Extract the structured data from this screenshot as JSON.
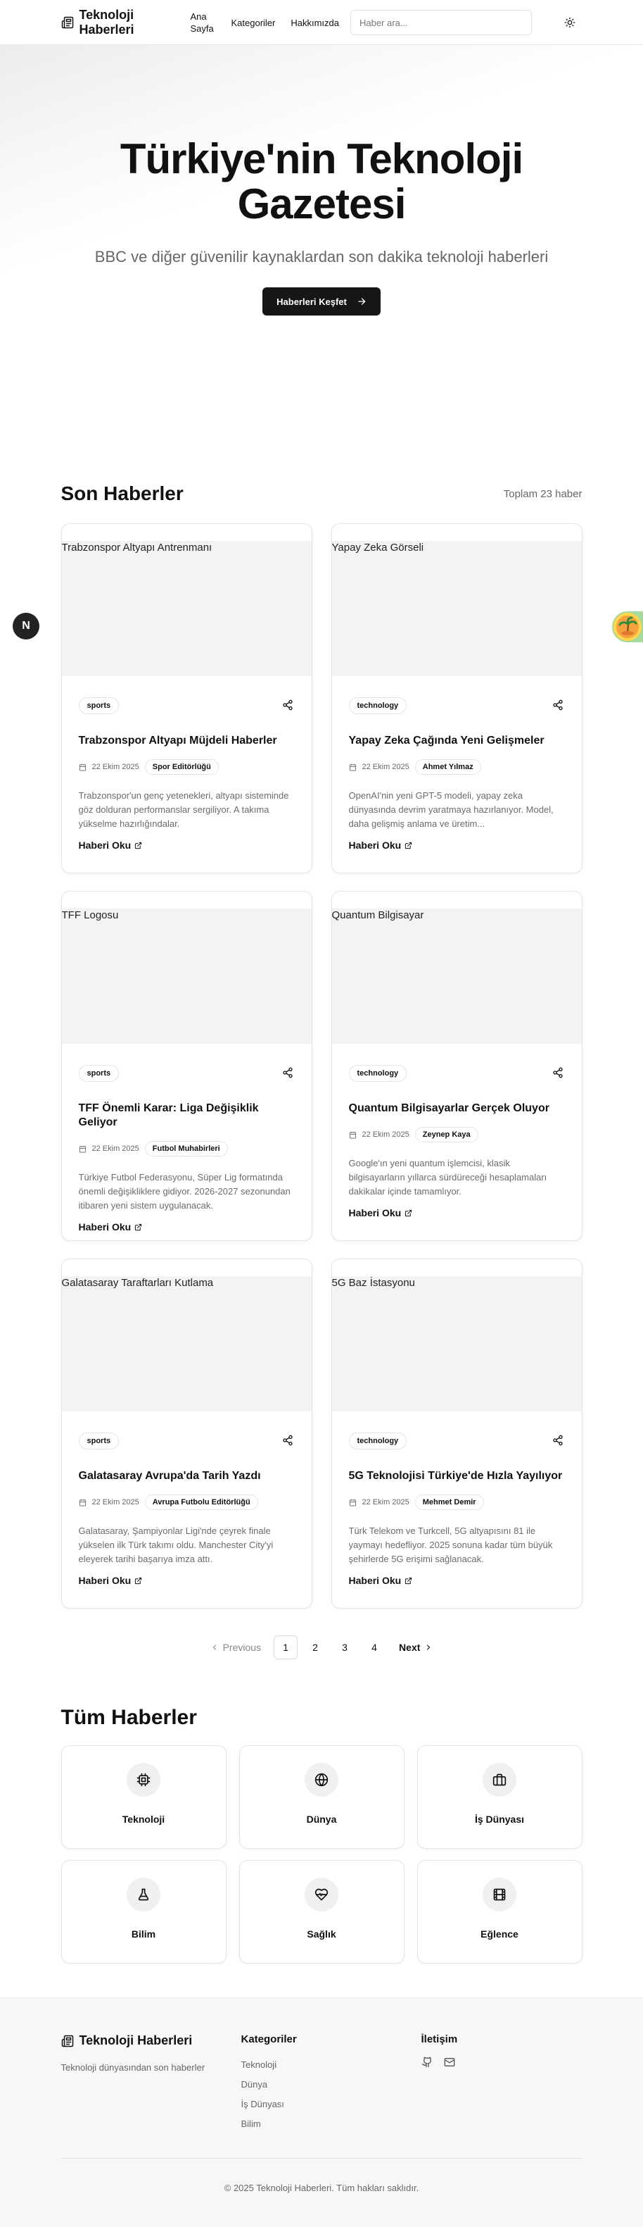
{
  "header": {
    "title": "Teknoloji Haberleri",
    "nav": [
      "Ana Sayfa",
      "Kategoriler",
      "Hakkımızda"
    ],
    "search_placeholder": "Haber ara..."
  },
  "hero": {
    "title": "Türkiye'nin Teknoloji Gazetesi",
    "subtitle": "BBC ve diğer güvenilir kaynaklardan son dakika teknoloji haberleri",
    "button": "Haberleri Keşfet"
  },
  "latest": {
    "title": "Son Haberler",
    "count": "Toplam 23 haber",
    "read_label": "Haberi Oku",
    "articles": [
      {
        "image_alt": "Trabzonspor Altyapı Antrenmanı",
        "category": "sports",
        "title": "Trabzonspor Altyapı Müjdeli Haberler",
        "date": "22 Ekim 2025",
        "author": "Spor Editörlüğü",
        "desc": "Trabzonspor'un genç yetenekleri, altyapı sisteminde göz dolduran performanslar sergiliyor. A takıma yükselme hazırlığındalar."
      },
      {
        "image_alt": "Yapay Zeka Görseli",
        "category": "technology",
        "title": "Yapay Zeka Çağında Yeni Gelişmeler",
        "date": "22 Ekim 2025",
        "author": "Ahmet Yılmaz",
        "desc": "OpenAI'nin yeni GPT-5 modeli, yapay zeka dünyasında devrim yaratmaya hazırlanıyor. Model, daha gelişmiş anlama ve üretim..."
      },
      {
        "image_alt": "TFF Logosu",
        "category": "sports",
        "title": "TFF Önemli Karar: Liga Değişiklik Geliyor",
        "date": "22 Ekim 2025",
        "author": "Futbol Muhabirleri",
        "desc": "Türkiye Futbol Federasyonu, Süper Lig formatında önemli değişikliklere gidiyor. 2026-2027 sezonundan itibaren yeni sistem uygulanacak."
      },
      {
        "image_alt": "Quantum Bilgisayar",
        "category": "technology",
        "title": "Quantum Bilgisayarlar Gerçek Oluyor",
        "date": "22 Ekim 2025",
        "author": "Zeynep Kaya",
        "desc": "Google'ın yeni quantum işlemcisi, klasik bilgisayarların yıllarca sürdüreceği hesaplamaları dakikalar içinde tamamlıyor."
      },
      {
        "image_alt": "Galatasaray Taraftarları Kutlama",
        "category": "sports",
        "title": "Galatasaray Avrupa'da Tarih Yazdı",
        "date": "22 Ekim 2025",
        "author": "Avrupa Futbolu Editörlüğü",
        "desc": "Galatasaray, Şampiyonlar Ligi'nde çeyrek finale yükselen ilk Türk takımı oldu. Manchester City'yi eleyerek tarihi başarıya imza attı."
      },
      {
        "image_alt": "5G Baz İstasyonu",
        "category": "technology",
        "title": "5G Teknolojisi Türkiye'de Hızla Yayılıyor",
        "date": "22 Ekim 2025",
        "author": "Mehmet Demir",
        "desc": "Türk Telekom ve Turkcell, 5G altyapısını 81 ile yaymayı hedefliyor. 2025 sonuna kadar tüm büyük şehirlerde 5G erişimi sağlanacak."
      }
    ]
  },
  "pagination": {
    "previous": "Previous",
    "pages": [
      "1",
      "2",
      "3",
      "4"
    ],
    "next": "Next",
    "current": "1"
  },
  "categories": {
    "title": "Tüm Haberler",
    "items": [
      {
        "label": "Teknoloji",
        "icon": "cpu-icon"
      },
      {
        "label": "Dünya",
        "icon": "globe-icon"
      },
      {
        "label": "İş Dünyası",
        "icon": "briefcase-icon"
      },
      {
        "label": "Bilim",
        "icon": "flask-icon"
      },
      {
        "label": "Sağlık",
        "icon": "heart-pulse-icon"
      },
      {
        "label": "Eğlence",
        "icon": "film-icon"
      }
    ]
  },
  "footer": {
    "brand": "Teknoloji Haberleri",
    "tagline": "Teknoloji dünyasından son haberler",
    "categories_title": "Kategoriler",
    "categories": [
      "Teknoloji",
      "Dünya",
      "İş Dünyası",
      "Bilim"
    ],
    "contact_title": "İletişim",
    "copyright": "© 2025 Teknoloji Haberleri. Tüm hakları saklıdır."
  },
  "floating": {
    "badge_letter": "N"
  },
  "colors": {
    "primary_button": "#161616",
    "text": "#111111",
    "muted": "#666666"
  }
}
